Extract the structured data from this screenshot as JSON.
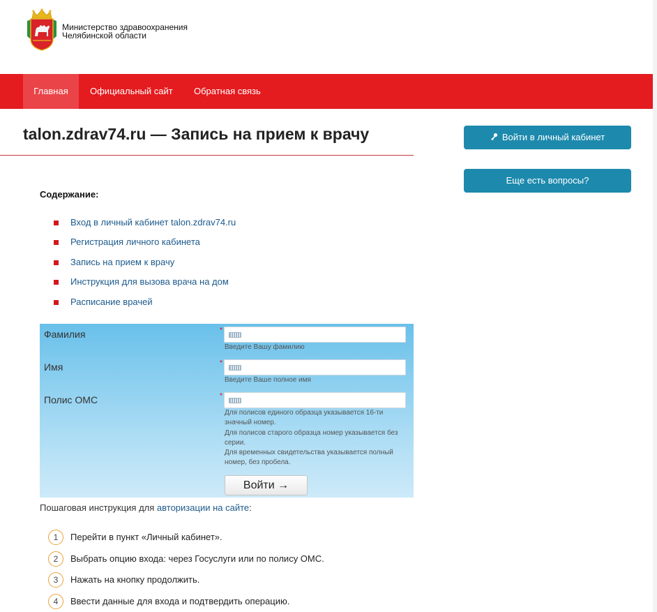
{
  "header": {
    "ministry_line1": "Министерство здравоохранения",
    "ministry_line2": "Челябинской области"
  },
  "nav": {
    "items": [
      {
        "label": "Главная",
        "active": true
      },
      {
        "label": "Официальный сайт",
        "active": false
      },
      {
        "label": "Обратная связь",
        "active": false
      }
    ]
  },
  "page": {
    "title": "talon.zdrav74.ru — Запись на прием к врачу"
  },
  "sidebar": {
    "login_button": "Войти в личный кабинет",
    "questions_button": "Еще есть вопросы?"
  },
  "toc": {
    "heading": "Содержание:",
    "items": [
      "Вход в личный кабинет talon.zdrav74.ru",
      "Регистрация личного кабинета",
      "Запись на прием к врачу",
      "Инструкция для вызова врача на дом",
      "Расписание врачей"
    ]
  },
  "form": {
    "surname_label": "Фамилия",
    "surname_hint": "Введите Вашу фамилию",
    "surname_value": "",
    "name_label": "Имя",
    "name_hint": "Введите Ваше полное имя",
    "name_value": "",
    "policy_label": "Полис ОМС",
    "policy_value": "",
    "policy_hint_1": "Для полисов единого образца указывается 16-ти значный номер.",
    "policy_hint_2": "Для полисов старого образца номер указывается без серии.",
    "policy_hint_3": "Для временных свидетельства указывается полный номер, без пробела.",
    "required_mark": "*",
    "submit": "Войти →"
  },
  "instructions": {
    "intro_text": "Пошаговая инструкция для ",
    "intro_link": "авторизации на сайте",
    "intro_end": ":",
    "steps": [
      {
        "num": "1",
        "text": "Перейти в пункт «Личный кабинет»."
      },
      {
        "num": "2",
        "text": "Выбрать опцию входа: через Госуслуги или по полису ОМС."
      },
      {
        "num": "3",
        "text": "Нажать на кнопку продолжить."
      },
      {
        "num": "4",
        "text": "Ввести данные для входа и подтвердить операцию."
      }
    ]
  },
  "colors": {
    "nav_red": "#e41b1f",
    "nav_active": "#ea4448",
    "button_blue": "#1d8aad",
    "link_blue": "#1c5a8c",
    "bullet_red": "#d0191e",
    "step_circle": "#e8a33b"
  },
  "icons": {
    "logo": "chelyabinsk-coat-of-arms",
    "key": "key-icon",
    "keyboard": "keyboard-icon"
  }
}
